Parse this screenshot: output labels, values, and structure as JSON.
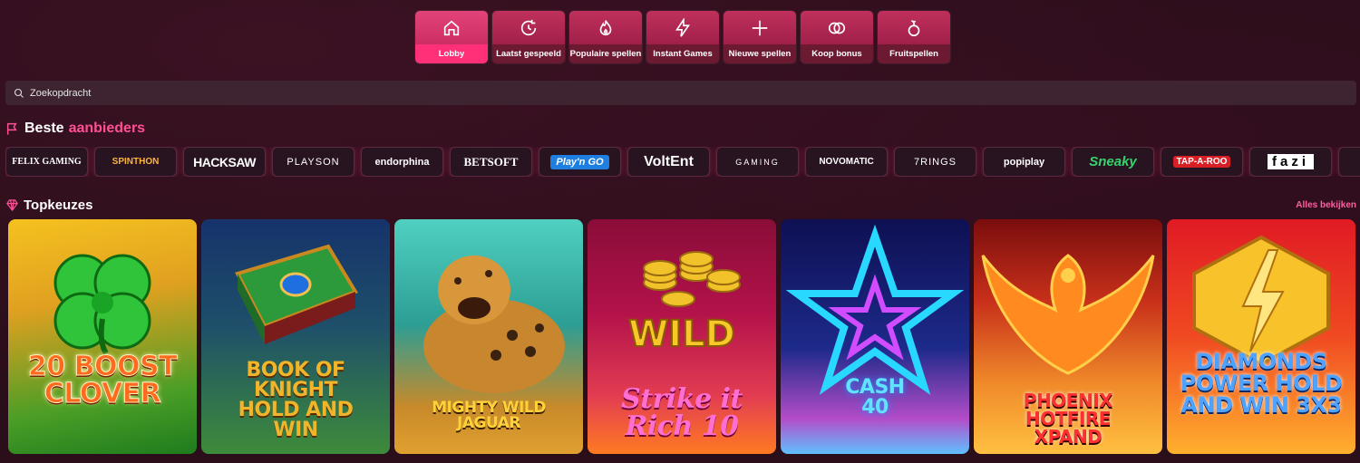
{
  "categories": [
    {
      "label": "Lobby",
      "icon": "home-icon",
      "active": true
    },
    {
      "label": "Laatst gespeeld",
      "icon": "history-icon"
    },
    {
      "label": "Populaire spellen",
      "icon": "flame-icon"
    },
    {
      "label": "Instant Games",
      "icon": "lightning-icon"
    },
    {
      "label": "Nieuwe spellen",
      "icon": "plus-icon"
    },
    {
      "label": "Koop bonus",
      "icon": "coins-icon"
    },
    {
      "label": "Fruitspellen",
      "icon": "fruit-icon"
    }
  ],
  "search": {
    "placeholder": "Zoekopdracht"
  },
  "providers_section": {
    "title_a": "Beste",
    "title_b": "aanbieders"
  },
  "providers": [
    {
      "name": "FELIX GAMING",
      "color": "#ffffff"
    },
    {
      "name": "SPINTHON",
      "color": "#ffb43a"
    },
    {
      "name": "HACKSAW",
      "color": "#ffffff"
    },
    {
      "name": "PLAYSON",
      "color": "#ffffff"
    },
    {
      "name": "endorphina",
      "color": "#ffffff"
    },
    {
      "name": "BETSOFT",
      "color": "#ffffff"
    },
    {
      "name": "Play'n GO",
      "color": "#1e90ff"
    },
    {
      "name": "VoltEnt",
      "color": "#ffffff"
    },
    {
      "name": "GAMING",
      "color": "#ffffff"
    },
    {
      "name": "NOVOMATIC",
      "color": "#ffffff"
    },
    {
      "name": "7RINGS",
      "color": "#ffffff"
    },
    {
      "name": "popiplay",
      "color": "#ffffff"
    },
    {
      "name": "Sneaky",
      "color": "#35d36b"
    },
    {
      "name": "TAP-A-ROO",
      "color": "#ff3b3b"
    },
    {
      "name": "fazi",
      "color": "#ffffff"
    },
    {
      "name": "",
      "color": "#ffffff"
    }
  ],
  "top_section": {
    "title": "Topkeuzes",
    "see_all": "Alles bekijken"
  },
  "games": [
    {
      "title": "20 BOOST CLOVER",
      "bg1": "#f2a322",
      "bg2": "#2a8c25",
      "text": "#ff5a1f"
    },
    {
      "title": "BOOK OF KNIGHT HOLD AND WIN",
      "bg1": "#1e3a8a",
      "bg2": "#4aa040",
      "text": "#f0b52b"
    },
    {
      "title": "MIGHTY WILD JAGUAR",
      "bg1": "#2fb3a6",
      "bg2": "#d69a2a",
      "text": "#ffd23a"
    },
    {
      "title": "Strike it Rich 10",
      "bg1": "#b3104a",
      "bg2": "#ff6a22",
      "text": "#ff6fd1"
    },
    {
      "title": "CASH 40",
      "bg1": "#161866",
      "bg2": "#5fb6ff",
      "text": "#5fe3ff"
    },
    {
      "title": "PHOENIX HOTFIRE XPAND",
      "bg1": "#7a0d0d",
      "bg2": "#ffb13a",
      "text": "#ff3030"
    },
    {
      "title": "DIAMONDS POWER HOLD AND WIN 3X3",
      "bg1": "#d8141e",
      "bg2": "#ffb02e",
      "text": "#4fa3ff"
    }
  ]
}
